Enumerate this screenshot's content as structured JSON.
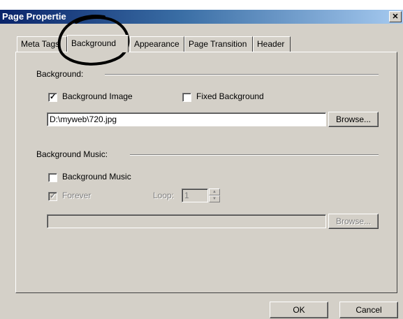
{
  "window": {
    "title": "Page Propertie",
    "close_glyph": "✕"
  },
  "tabs": [
    {
      "label": "Meta Tags"
    },
    {
      "label": "Background"
    },
    {
      "label": "Appearance"
    },
    {
      "label": "Page Transition"
    },
    {
      "label": "Header"
    }
  ],
  "active_tab": "Background",
  "background_group": {
    "heading": "Background:",
    "image_checkbox": {
      "label": "Background Image",
      "checked": true,
      "mark": "✓"
    },
    "fixed_checkbox": {
      "label": "Fixed Background",
      "checked": false
    },
    "path_value": "D:\\myweb\\720.jpg",
    "browse_label": "Browse..."
  },
  "music_group": {
    "heading": "Background Music:",
    "music_checkbox": {
      "label": "Background Music",
      "checked": false
    },
    "forever_checkbox": {
      "label": "Forever",
      "checked": true,
      "disabled": true,
      "mark": "✓"
    },
    "loop_label": "Loop:",
    "loop_value": "1",
    "path_value": "",
    "browse_label": "Browse..."
  },
  "footer": {
    "ok_label": "OK",
    "cancel_label": "Cancel"
  },
  "colors": {
    "dialog": "#d4d0c8",
    "title_start": "#0a246a",
    "title_end": "#a6caf0",
    "annotation": "#000000"
  }
}
